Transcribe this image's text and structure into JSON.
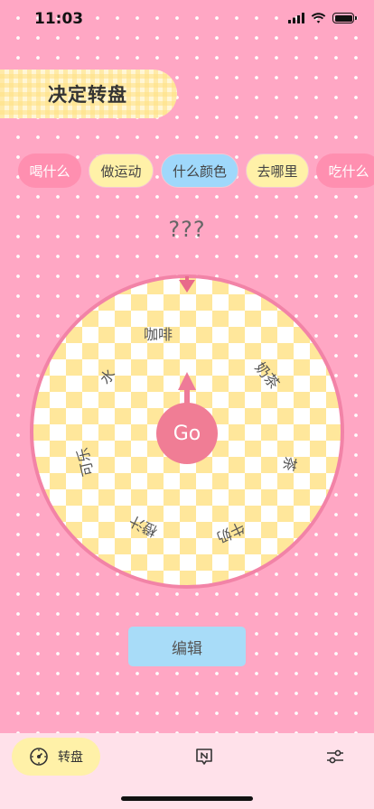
{
  "status_bar": {
    "time": "11:03"
  },
  "header": {
    "title": "决定转盘"
  },
  "categories": [
    {
      "label": "喝什么",
      "style": "pink"
    },
    {
      "label": "做运动",
      "style": "yellow"
    },
    {
      "label": "什么颜色",
      "style": "blue"
    },
    {
      "label": "去哪里",
      "style": "yellow"
    },
    {
      "label": "吃什么",
      "style": "pink"
    }
  ],
  "result": "???",
  "wheel": {
    "options": [
      "咖啡",
      "奶茶",
      "茶",
      "牛奶",
      "橙汁",
      "可乐",
      "水"
    ],
    "go_label": "Go",
    "colors": {
      "rim": "#f283a7",
      "check": "#ffe79b",
      "go": "#f07d95"
    }
  },
  "edit_button": {
    "label": "编辑"
  },
  "tab_bar": {
    "wheel_tab": {
      "label": "转盘",
      "icon": "wheel-icon"
    },
    "note_tab": {
      "icon": "note-n-icon"
    },
    "settings_tab": {
      "icon": "sliders-icon"
    }
  }
}
